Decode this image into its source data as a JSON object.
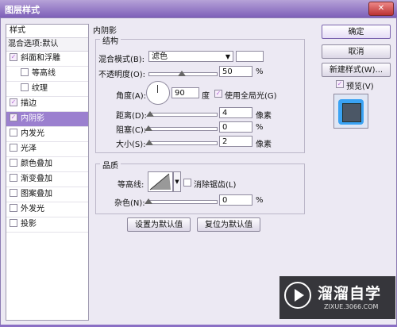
{
  "window": {
    "title": "图层样式",
    "close_label": "✕"
  },
  "left_panel": {
    "header": "样式",
    "blend_options": "混合选项:默认",
    "items": [
      {
        "label": "斜面和浮雕",
        "checked": true,
        "sub": false,
        "selected": false
      },
      {
        "label": "等高线",
        "checked": false,
        "sub": true,
        "selected": false
      },
      {
        "label": "纹理",
        "checked": false,
        "sub": true,
        "selected": false
      },
      {
        "label": "描边",
        "checked": true,
        "sub": false,
        "selected": false
      },
      {
        "label": "内阴影",
        "checked": true,
        "sub": false,
        "selected": true
      },
      {
        "label": "内发光",
        "checked": false,
        "sub": false,
        "selected": false
      },
      {
        "label": "光泽",
        "checked": false,
        "sub": false,
        "selected": false
      },
      {
        "label": "颜色叠加",
        "checked": false,
        "sub": false,
        "selected": false
      },
      {
        "label": "渐变叠加",
        "checked": false,
        "sub": false,
        "selected": false
      },
      {
        "label": "图案叠加",
        "checked": false,
        "sub": false,
        "selected": false
      },
      {
        "label": "外发光",
        "checked": false,
        "sub": false,
        "selected": false
      },
      {
        "label": "投影",
        "checked": false,
        "sub": false,
        "selected": false
      }
    ]
  },
  "inner_shadow": {
    "section_title": "内阴影",
    "structure": {
      "title": "结构",
      "blend_mode_label": "混合模式(B):",
      "blend_mode_value": "滤色",
      "blend_color": "#ffffff",
      "opacity_label": "不透明度(O):",
      "opacity_value": "50",
      "opacity_unit": "%",
      "opacity_fraction": 0.5,
      "angle_label": "角度(A):",
      "angle_value": "90",
      "angle_unit": "度",
      "global_light_label": "使用全局光(G)",
      "global_light_checked": true,
      "distance_label": "距离(D):",
      "distance_value": "4",
      "distance_unit": "像素",
      "choke_label": "阻塞(C):",
      "choke_value": "0",
      "choke_unit": "%",
      "size_label": "大小(S):",
      "size_value": "2",
      "size_unit": "像素"
    },
    "quality": {
      "title": "品质",
      "contour_label": "等高线:",
      "anti_alias_label": "消除锯齿(L)",
      "anti_alias_checked": false,
      "noise_label": "杂色(N):",
      "noise_value": "0",
      "noise_unit": "%"
    },
    "set_default_label": "设置为默认值",
    "reset_default_label": "复位为默认值"
  },
  "right_panel": {
    "ok_label": "确定",
    "cancel_label": "取消",
    "new_style_label": "新建样式(W)...",
    "preview_label": "预览(V)",
    "preview_checked": true
  },
  "watermark": {
    "title": "溜溜自学",
    "subtitle": "ZIXUE.3066.COM"
  }
}
